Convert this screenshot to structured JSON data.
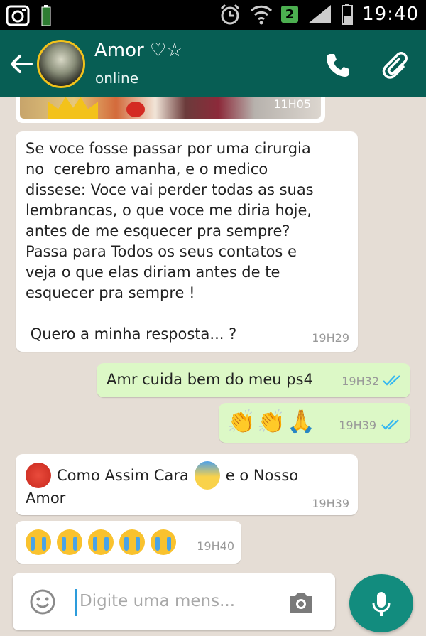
{
  "status_bar": {
    "time": "19:40",
    "badge": "2",
    "icons": [
      "instagram-icon",
      "battery-small-icon",
      "alarm-icon",
      "wifi-icon",
      "signal-icon",
      "battery-icon"
    ]
  },
  "header": {
    "contact_name": "Amor ♡☆",
    "status": "online",
    "icons": [
      "back-arrow-icon",
      "phone-icon",
      "paperclip-icon"
    ]
  },
  "messages": [
    {
      "type": "image",
      "direction": "in",
      "time": "11H05"
    },
    {
      "direction": "in",
      "text": "Se voce fosse passar por uma cirurgia\nno  cerebro amanha, e o medico\ndissese: Voce vai perder todas as suas\nlembrancas, o que voce me diria hoje,\nantes de me esquecer pra sempre?\nPassa para Todos os seus contatos e\nveja o que elas diriam antes de te\nesquecer pra sempre !\n\n Quero a minha resposta... ?",
      "time": "19H29"
    },
    {
      "direction": "out",
      "text": "Amr cuida bem do meu ps4",
      "time": "19H32",
      "status": "read"
    },
    {
      "direction": "out",
      "emojis": [
        "clapping-hands-emoji",
        "clapping-hands-emoji",
        "folded-hands-emoji"
      ],
      "time": "19H39",
      "status": "read"
    },
    {
      "direction": "in",
      "text_before": "Como Assim Cara",
      "text_after": "e o Nosso",
      "text_line2": "Amor",
      "emojis": [
        "angry-face-emoji",
        "screaming-face-emoji"
      ],
      "time": "19H39"
    },
    {
      "direction": "in",
      "emojis": [
        "crying-face-emoji",
        "crying-face-emoji",
        "crying-face-emoji",
        "crying-face-emoji",
        "crying-face-emoji"
      ],
      "time": "19H40"
    }
  ],
  "input": {
    "placeholder": "Digite uma mens..."
  },
  "colors": {
    "header": "#075e54",
    "chat_background": "#e5ddd5",
    "outgoing_bubble": "#dcf8c6",
    "incoming_bubble": "#ffffff",
    "read_ticks": "#34b7f1",
    "mic_button": "#128c7e"
  }
}
